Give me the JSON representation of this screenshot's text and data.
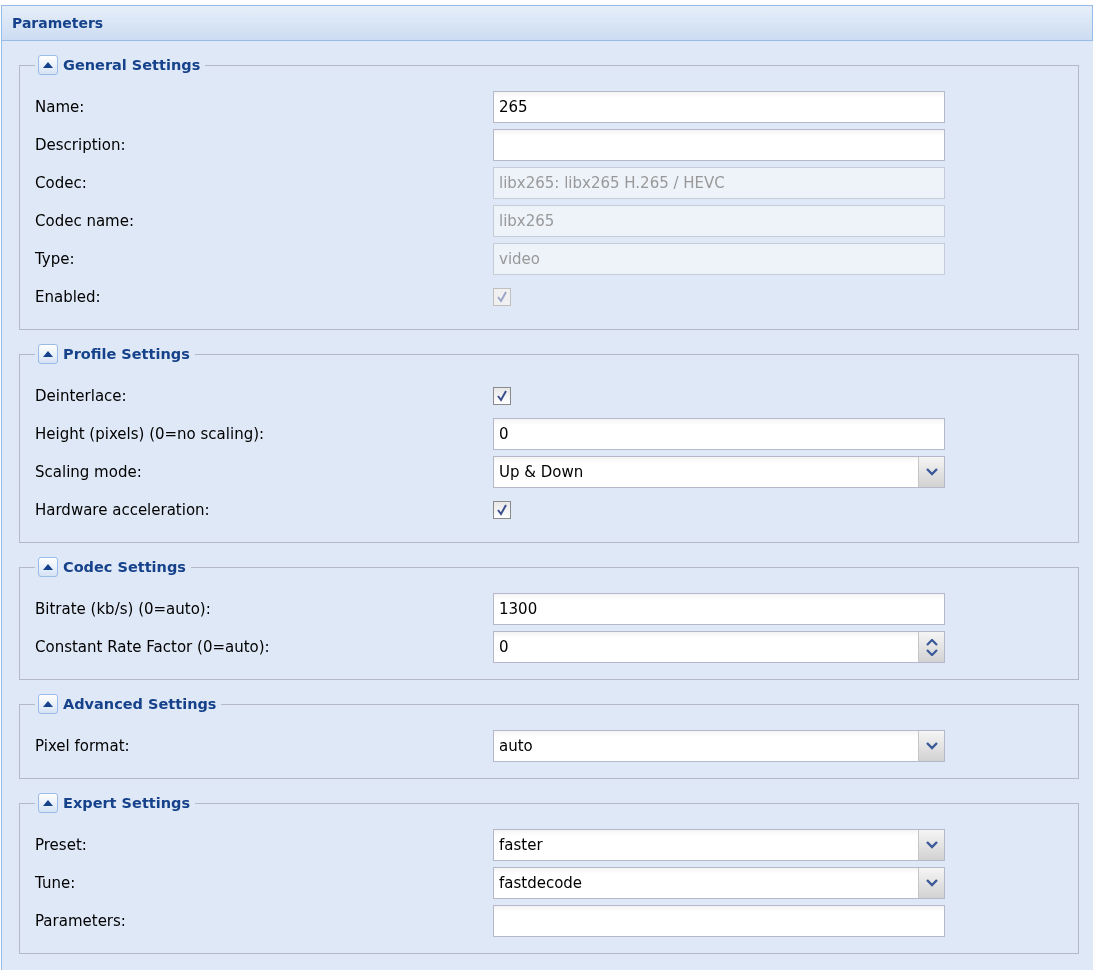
{
  "panel": {
    "title": "Parameters"
  },
  "sections": [
    {
      "title": "General Settings",
      "expanded": true,
      "fields": [
        {
          "kind": "text",
          "label": "Name:",
          "value": "265",
          "disabled": false
        },
        {
          "kind": "text",
          "label": "Description:",
          "disabled": false
        },
        {
          "kind": "text",
          "label": "Codec:",
          "value": "libx265: libx265 H.265 / HEVC",
          "disabled": true
        },
        {
          "kind": "text",
          "label": "Codec name:",
          "value": "libx265",
          "disabled": true
        },
        {
          "kind": "text",
          "label": "Type:",
          "value": "video",
          "disabled": true
        },
        {
          "kind": "checkbox",
          "label": "Enabled:",
          "checked": true,
          "disabled": true
        }
      ]
    },
    {
      "title": "Profile Settings",
      "expanded": true,
      "fields": [
        {
          "kind": "checkbox",
          "label": "Deinterlace:",
          "checked": true,
          "disabled": false
        },
        {
          "kind": "text",
          "label": "Height (pixels) (0=no scaling):",
          "value": "0",
          "disabled": false
        },
        {
          "kind": "combo",
          "label": "Scaling mode:",
          "value": "Up & Down",
          "disabled": false
        },
        {
          "kind": "checkbox",
          "label": "Hardware acceleration:",
          "checked": true,
          "disabled": false
        }
      ]
    },
    {
      "title": "Codec Settings",
      "expanded": true,
      "fields": [
        {
          "kind": "text",
          "label": "Bitrate (kb/s) (0=auto):",
          "value": "1300",
          "disabled": false
        },
        {
          "kind": "spinner",
          "label": "Constant Rate Factor (0=auto):",
          "value": "0",
          "disabled": false
        }
      ]
    },
    {
      "title": "Advanced Settings",
      "expanded": true,
      "fields": [
        {
          "kind": "combo",
          "label": "Pixel format:",
          "value": "auto",
          "disabled": false
        }
      ]
    },
    {
      "title": "Expert Settings",
      "expanded": true,
      "fields": [
        {
          "kind": "combo",
          "label": "Preset:",
          "value": "faster",
          "disabled": false
        },
        {
          "kind": "combo",
          "label": "Tune:",
          "value": "fastdecode",
          "disabled": false
        },
        {
          "kind": "text",
          "label": "Parameters:",
          "disabled": false
        }
      ]
    }
  ]
}
